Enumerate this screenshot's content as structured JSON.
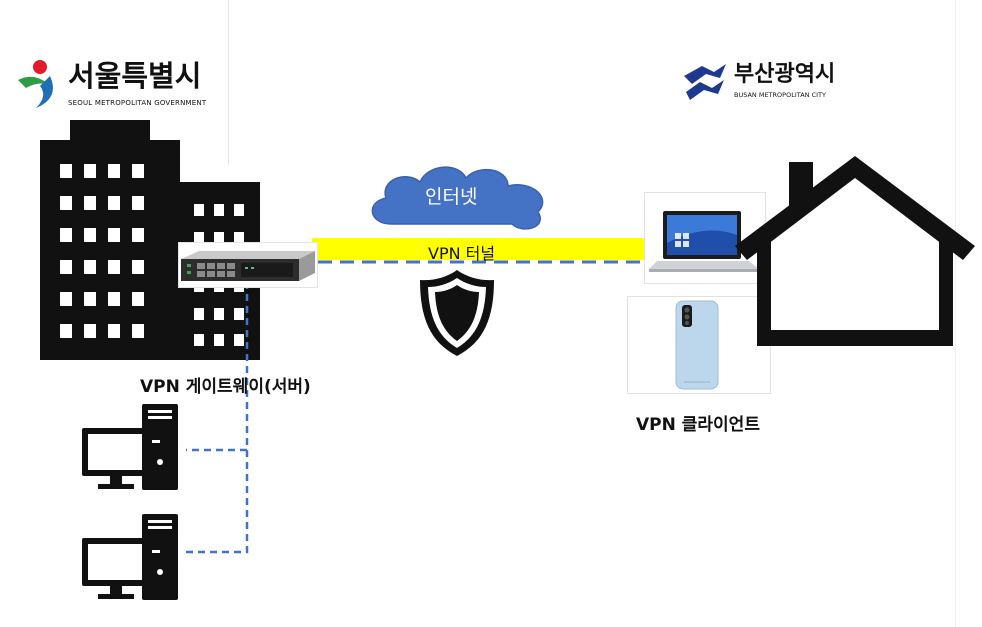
{
  "seoul_logo": {
    "name": "서울특별시",
    "subtitle": "SEOUL METROPOLITAN GOVERNMENT"
  },
  "busan_logo": {
    "name": "부산광역시",
    "subtitle": "BUSAN METROPOLITAN CITY"
  },
  "internet_label": "인터넷",
  "tunnel_label": "VPN 터널",
  "gateway_label": "VPN 게이트웨이(서버)",
  "client_label": "VPN 클라이언트",
  "colors": {
    "tunnel": "#ffff00",
    "cloud": "#4472c4",
    "dashed_line": "#4472c4",
    "seoul_red": "#e21a2c",
    "seoul_blue": "#1f6fb8",
    "seoul_green": "#2e9d45",
    "busan_blue": "#1d3a8f"
  },
  "icons": [
    "seoul-emblem-icon",
    "busan-emblem-icon",
    "office-building-icon",
    "rack-server-icon",
    "cloud-icon",
    "shield-icon",
    "laptop-icon",
    "smartphone-icon",
    "house-icon",
    "desktop-pc-icon"
  ]
}
